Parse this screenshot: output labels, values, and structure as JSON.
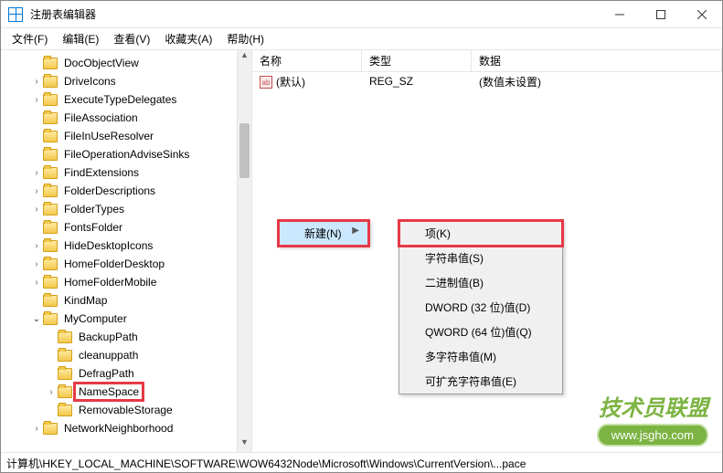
{
  "window": {
    "title": "注册表编辑器"
  },
  "menubar": {
    "file": "文件(F)",
    "edit": "编辑(E)",
    "view": "查看(V)",
    "favorites": "收藏夹(A)",
    "help": "帮助(H)"
  },
  "tree": {
    "items": [
      {
        "label": "DocObjectView",
        "depth": 2,
        "chev": ""
      },
      {
        "label": "DriveIcons",
        "depth": 2,
        "chev": "›"
      },
      {
        "label": "ExecuteTypeDelegates",
        "depth": 2,
        "chev": "›"
      },
      {
        "label": "FileAssociation",
        "depth": 2,
        "chev": ""
      },
      {
        "label": "FileInUseResolver",
        "depth": 2,
        "chev": ""
      },
      {
        "label": "FileOperationAdviseSinks",
        "depth": 2,
        "chev": ""
      },
      {
        "label": "FindExtensions",
        "depth": 2,
        "chev": "›"
      },
      {
        "label": "FolderDescriptions",
        "depth": 2,
        "chev": "›"
      },
      {
        "label": "FolderTypes",
        "depth": 2,
        "chev": "›"
      },
      {
        "label": "FontsFolder",
        "depth": 2,
        "chev": ""
      },
      {
        "label": "HideDesktopIcons",
        "depth": 2,
        "chev": "›"
      },
      {
        "label": "HomeFolderDesktop",
        "depth": 2,
        "chev": "›"
      },
      {
        "label": "HomeFolderMobile",
        "depth": 2,
        "chev": "›"
      },
      {
        "label": "KindMap",
        "depth": 2,
        "chev": ""
      },
      {
        "label": "MyComputer",
        "depth": 2,
        "chev": "⌄",
        "expanded": true
      },
      {
        "label": "BackupPath",
        "depth": 3,
        "chev": ""
      },
      {
        "label": "cleanuppath",
        "depth": 3,
        "chev": ""
      },
      {
        "label": "DefragPath",
        "depth": 3,
        "chev": ""
      },
      {
        "label": "NameSpace",
        "depth": 3,
        "chev": "›",
        "selected": true
      },
      {
        "label": "RemovableStorage",
        "depth": 3,
        "chev": ""
      },
      {
        "label": "NetworkNeighborhood",
        "depth": 2,
        "chev": "›"
      }
    ]
  },
  "list": {
    "columns": {
      "name": "名称",
      "type": "类型",
      "data": "数据"
    },
    "rows": [
      {
        "name": "(默认)",
        "type": "REG_SZ",
        "data": "(数值未设置)"
      }
    ]
  },
  "context_menu1": {
    "new": "新建(N)"
  },
  "context_menu2": {
    "key": "项(K)",
    "string": "字符串值(S)",
    "binary": "二进制值(B)",
    "dword": "DWORD (32 位)值(D)",
    "qword": "QWORD (64 位)值(Q)",
    "multi": "多字符串值(M)",
    "expand": "可扩充字符串值(E)"
  },
  "statusbar": {
    "path": "计算机\\HKEY_LOCAL_MACHINE\\SOFTWARE\\WOW6432Node\\Microsoft\\Windows\\CurrentVersion\\...pace"
  },
  "watermark": {
    "text": "技术员联盟",
    "url": "www.jsgho.com"
  }
}
